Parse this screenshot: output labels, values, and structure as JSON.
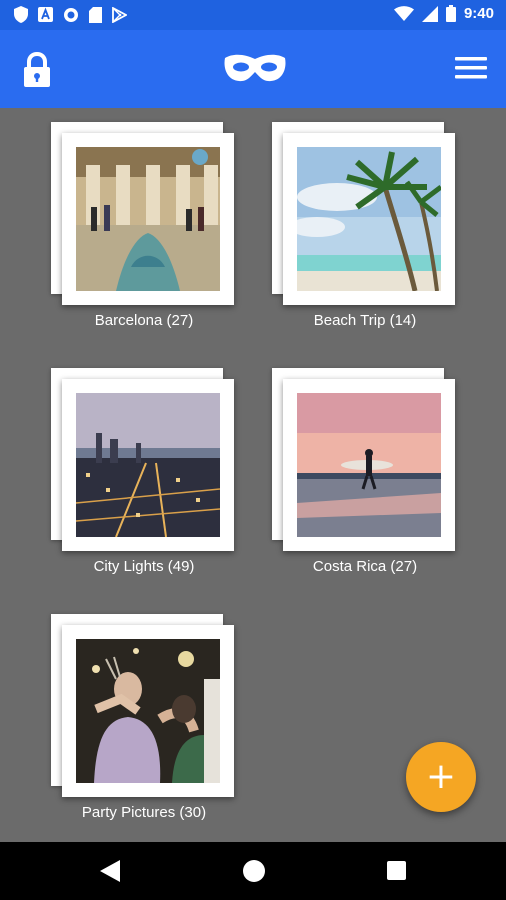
{
  "status_bar": {
    "time": "9:40",
    "left_icons": [
      "shield-icon",
      "a-icon",
      "circle-icon",
      "sd-card-icon",
      "play-store-icon"
    ],
    "right_icons": [
      "wifi-icon",
      "signal-icon",
      "battery-icon"
    ]
  },
  "app_bar": {
    "left_icon": "lock-icon",
    "logo_icon": "mask-icon",
    "right_icon": "menu-icon",
    "color": "#2a6cf0"
  },
  "albums": [
    {
      "label": "Barcelona (27)"
    },
    {
      "label": "Beach Trip (14)"
    },
    {
      "label": "City Lights (49)"
    },
    {
      "label": "Costa Rica (27)"
    },
    {
      "label": "Party Pictures (30)"
    }
  ],
  "fab": {
    "icon": "plus-icon",
    "label": "+",
    "color": "#f5a623"
  },
  "nav_bar": {
    "icons": [
      "back-icon",
      "home-icon",
      "recents-icon"
    ]
  }
}
